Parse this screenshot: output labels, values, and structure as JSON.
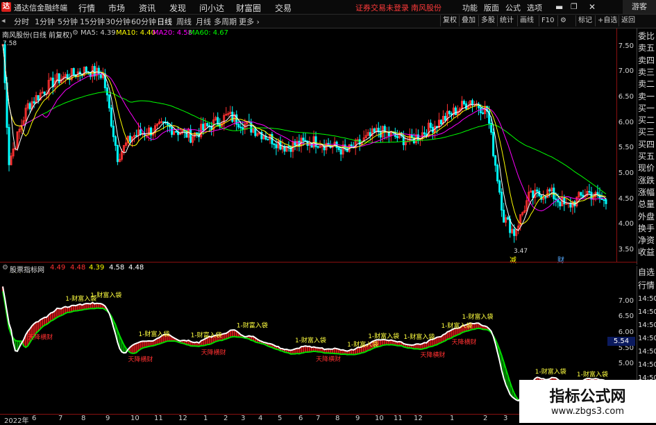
{
  "app": {
    "logo": "达",
    "name": "通达信金融终端",
    "menu": [
      "行情",
      "市场",
      "资讯",
      "发现",
      "问小达",
      "财富圈",
      "交易"
    ],
    "notice": "证券交易未登录",
    "stock_badge": "南风股份",
    "right_menu": [
      "功能",
      "版面",
      "公式",
      "选项"
    ],
    "guest": "游客"
  },
  "toolbar": {
    "periods": [
      "分时",
      "1分钟",
      "5分钟",
      "15分钟",
      "30分钟",
      "60分钟",
      "日线",
      "周线",
      "月线",
      "多周期"
    ],
    "active_period": "日线",
    "more": "更多 ›",
    "right_buttons": [
      "复权",
      "叠加",
      "多股",
      "统计",
      "画线",
      "F10",
      "标记",
      "+自选",
      "返回"
    ]
  },
  "main_chart": {
    "title": "南风股份(日线 前复权)",
    "ma": [
      {
        "label": "MA5: 4.39",
        "color": "#ffffff"
      },
      {
        "label": "MA10: 4.40",
        "color": "#ffff00"
      },
      {
        "label": "MA20: 4.58",
        "color": "#ff00ff"
      },
      {
        "label": "MA60: 4.67",
        "color": "#00ff00"
      }
    ],
    "y_ticks": [
      "7.50",
      "7.00",
      "6.50",
      "6.00",
      "5.50",
      "5.00",
      "4.50",
      "4.00",
      "3.50"
    ],
    "high_label": "7.58",
    "low_label": "3.47",
    "event_labels": [
      "减",
      "财"
    ]
  },
  "right_panel": {
    "top_items": [
      "委比",
      "卖五",
      "卖四",
      "卖三",
      "卖二",
      "卖一",
      "买一",
      "买二",
      "买三",
      "买四",
      "买五",
      "现价",
      "涨跌",
      "涨幅",
      "总量",
      "外盘",
      "换手",
      "净资",
      "收益"
    ],
    "bottom_items": [
      "自选",
      "行情",
      "14:50",
      "14:50",
      "14:50",
      "14:50",
      "14:50",
      "14:50",
      "14:50",
      "14:50",
      "14:50"
    ]
  },
  "indicator": {
    "name": "股票指标网",
    "values": [
      {
        "label": "4.49",
        "color": "#ff3030"
      },
      {
        "label": "4.48",
        "color": "#ff3030"
      },
      {
        "label": "4.39",
        "color": "#ffff00"
      },
      {
        "label": "4.58",
        "color": "#ffffff"
      },
      {
        "label": "4.48",
        "color": "#ffffff"
      }
    ],
    "y_ticks": [
      "7.00",
      "6.50",
      "6.00",
      "5.50",
      "5.00"
    ],
    "last_value": "5.54",
    "buy_signal": "1-财富入袋",
    "sell_signal": "天降横财"
  },
  "bottom_axis": {
    "labels": [
      "2022年",
      "6",
      "7",
      "8",
      "9",
      "10",
      "11",
      "12",
      "1",
      "2",
      "3",
      "4",
      "5",
      "6",
      "7",
      "8",
      "9",
      "10",
      "11",
      "12",
      "1",
      "2",
      "3"
    ]
  },
  "watermark": {
    "title": "指标公式网",
    "url": "www.zbgs3.com"
  },
  "colors": {
    "up": "#ff3030",
    "down": "#00ffff",
    "ma5": "#ffffff",
    "ma10": "#ffff00",
    "ma20": "#ff00ff",
    "ma60": "#00ff00",
    "frame": "#8a1010"
  }
}
